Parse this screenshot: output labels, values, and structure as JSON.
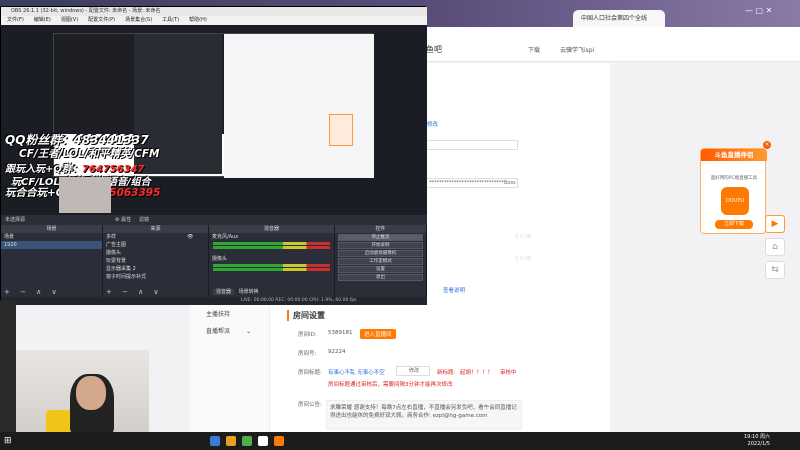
{
  "browser": {
    "tab_title": "中国人口社会第四个全线",
    "window_controls": "—  ▢  ✕"
  },
  "site_header": {
    "title_suffix": "鱼吧",
    "download_label": "下载",
    "user_label": "云骥学飞ispi"
  },
  "sidebar": {
    "items": [
      {
        "label": "主播扶持"
      },
      {
        "label": "直播帮派"
      }
    ]
  },
  "settings": {
    "section_title": "房间设置",
    "room_id_label": "房间ID:",
    "room_id_value": "5389181",
    "enter_room_button": "进入直播间",
    "room_number_label": "房间号:",
    "room_number_value": "92224",
    "room_title_label": "房间标题:",
    "room_title_value": "有事心不乱 无事心不空",
    "modify_label": "修改",
    "new_title_label": "新标题:",
    "new_title_value": "起胡！！！！",
    "status_label": "审核中",
    "title_warning": "房间标题通过审核后，需要间隔3分钟才能再次修改",
    "announce_label": "房间公告:",
    "announcement": "求雕荣耀 感谢支持！每晚7点左右直播，不直播会另发负吧，看午会同直播记得进出也能休的免费好双大佩。商务合作: ezpl@hg-game.com",
    "link_1": "修改",
    "link_2": "查看说明",
    "stream_key_partial": "******************************Boss"
  },
  "douyu_card": {
    "header": "斗鱼直播伴侣",
    "subtitle": "超好用的PC端直播工具",
    "logo_text": "DOUYU",
    "download_button": "立即下载",
    "close": "×"
  },
  "float_buttons": {
    "play": "▶",
    "home": "⌂",
    "share": "⇆"
  },
  "obs": {
    "title": "OBS 26.1.1 (32-bit, windows) - 配置文件: 未命名 - 场景: 未命名",
    "menu": [
      "文件(F)",
      "编辑(E)",
      "视图(V)",
      "配置文件(P)",
      "场景集合(S)",
      "工具(T)",
      "帮助(H)"
    ],
    "overlay": {
      "qq_fans": "QQ粉丝群：483441337",
      "games": "CF/王者/LOL/和平精英/CFM",
      "play_group_label": "跟玩入玩+Q群：",
      "play_group_number": "764756347",
      "games2": "玩CF/LOL/各种手游/语音/组合",
      "hang_group_label": "玩合合玩+QQ群：",
      "hang_group_number": "795063395"
    },
    "no_source": "未选择源",
    "prop_buttons": [
      "⚙ 属性",
      "滤镜"
    ],
    "docks": {
      "scenes": {
        "title": "场景",
        "items": [
          "场景",
          "1920"
        ]
      },
      "sources": {
        "title": "来源",
        "items": [
          "多样",
          "广告主图",
          "摄像头",
          "玩耍背景",
          "显示器采集 2",
          "窗子时间提示补式"
        ]
      },
      "mixer": {
        "title": "混音器",
        "ch1": "麦克风/Aux",
        "ch1_db": "0.0 dB",
        "ch2": "摄像头",
        "ch2_db": "0.0 dB",
        "tab1": "混音器",
        "tab2": "场景转换"
      },
      "controls": {
        "title": "控件",
        "buttons": [
          "停止推流",
          "开始录制",
          "启动虚拟摄像机",
          "工作室模式",
          "设置",
          "退出"
        ]
      },
      "footer_icons": "+ − ∧ ∨"
    },
    "status_bar": "LIVE: 00:00:00   REC: 00:00:00   CPU: 1.9%, 60.00 fps"
  },
  "taskbar": {
    "time": "19:10 周六",
    "date": "2022/1/5",
    "start": "⊞"
  }
}
